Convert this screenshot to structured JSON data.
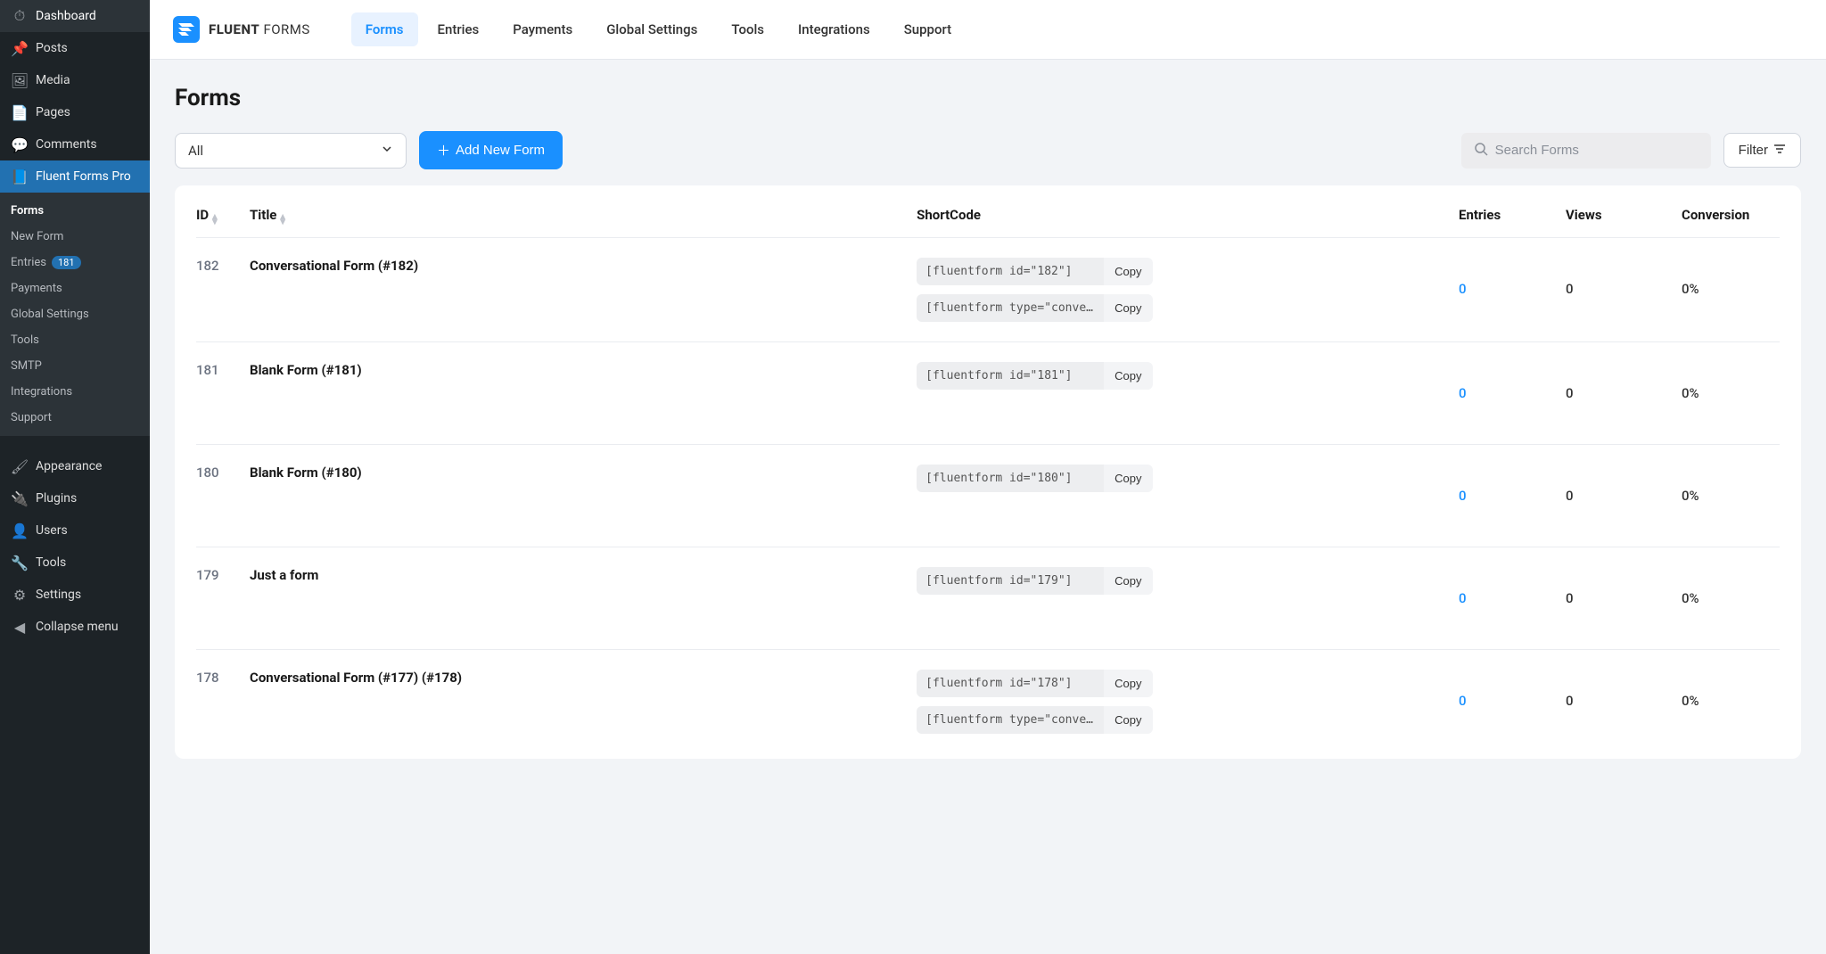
{
  "wp_sidebar": {
    "items": [
      {
        "label": "Dashboard",
        "icon": "⏱"
      },
      {
        "label": "Posts",
        "icon": "📌"
      },
      {
        "label": "Media",
        "icon": "🖼"
      },
      {
        "label": "Pages",
        "icon": "📄"
      },
      {
        "label": "Comments",
        "icon": "💬"
      },
      {
        "label": "Fluent Forms Pro",
        "icon": "📘",
        "active": true
      },
      {
        "label": "Appearance",
        "icon": "🖌"
      },
      {
        "label": "Plugins",
        "icon": "🔌"
      },
      {
        "label": "Users",
        "icon": "👤"
      },
      {
        "label": "Tools",
        "icon": "🔧"
      },
      {
        "label": "Settings",
        "icon": "⚙"
      },
      {
        "label": "Collapse menu",
        "icon": "◀"
      }
    ],
    "submenu": [
      {
        "label": "Forms",
        "current": true
      },
      {
        "label": "New Form"
      },
      {
        "label": "Entries",
        "badge": "181"
      },
      {
        "label": "Payments"
      },
      {
        "label": "Global Settings"
      },
      {
        "label": "Tools"
      },
      {
        "label": "SMTP"
      },
      {
        "label": "Integrations"
      },
      {
        "label": "Support"
      }
    ]
  },
  "topbar": {
    "logo_text_1": "FLUENT",
    "logo_text_2": " FORMS",
    "tabs": [
      {
        "label": "Forms",
        "active": true
      },
      {
        "label": "Entries"
      },
      {
        "label": "Payments"
      },
      {
        "label": "Global Settings"
      },
      {
        "label": "Tools"
      },
      {
        "label": "Integrations"
      },
      {
        "label": "Support"
      }
    ]
  },
  "page": {
    "title": "Forms",
    "filter_select": "All",
    "add_button": "Add New Form",
    "search_placeholder": "Search Forms",
    "filter_button": "Filter"
  },
  "table": {
    "headers": {
      "id": "ID",
      "title": "Title",
      "shortcode": "ShortCode",
      "entries": "Entries",
      "views": "Views",
      "conversion": "Conversion"
    },
    "copy_label": "Copy",
    "rows": [
      {
        "id": "182",
        "title": "Conversational Form (#182)",
        "shortcodes": [
          "[fluentform id=\"182\"]",
          "[fluentform type=\"conversa…"
        ],
        "entries": "0",
        "views": "0",
        "conversion": "0%"
      },
      {
        "id": "181",
        "title": "Blank Form (#181)",
        "shortcodes": [
          "[fluentform id=\"181\"]"
        ],
        "entries": "0",
        "views": "0",
        "conversion": "0%"
      },
      {
        "id": "180",
        "title": "Blank Form (#180)",
        "shortcodes": [
          "[fluentform id=\"180\"]"
        ],
        "entries": "0",
        "views": "0",
        "conversion": "0%"
      },
      {
        "id": "179",
        "title": "Just a form",
        "shortcodes": [
          "[fluentform id=\"179\"]"
        ],
        "entries": "0",
        "views": "0",
        "conversion": "0%"
      },
      {
        "id": "178",
        "title": "Conversational Form (#177) (#178)",
        "shortcodes": [
          "[fluentform id=\"178\"]",
          "[fluentform type=\"conversa…"
        ],
        "entries": "0",
        "views": "0",
        "conversion": "0%"
      }
    ]
  }
}
